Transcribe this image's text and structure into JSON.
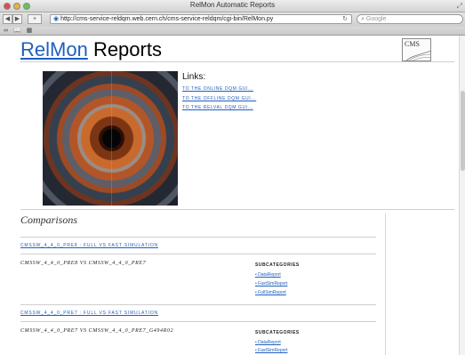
{
  "window": {
    "title": "RelMon Automatic Reports"
  },
  "toolbar": {
    "url": "http://cms-service-reldqm.web.cern.ch/cms-service-reldqm/cgi-bin/RelMon.py",
    "search_placeholder": "Google",
    "icons": [
      "back-icon",
      "forward-icon",
      "add-icon",
      "globe-icon",
      "reload-icon",
      "search-icon"
    ]
  },
  "bookmarks": {
    "icons": [
      "reading-list-icon",
      "bookmarks-icon",
      "grid-icon"
    ]
  },
  "header": {
    "brand": "RelMon",
    "title": "Reports",
    "logo_text": "CMS"
  },
  "links": {
    "title": "Links:",
    "items": [
      "TO THE ONLINE DQM GUI...",
      "TO THE OFFLINE DQM GUI...",
      "TO THE RELVAL DQM GUI..."
    ]
  },
  "comparisons": {
    "title": "Comparisons",
    "groups": [
      {
        "head": "CMSSW_4_4_0_PRE8 : FULL VS FAST SIMULATION",
        "row": "CMSSW_4_4_0_PRE8 VS CMSSW_4_4_0_PRE7",
        "subcategories_label": "SUBCATEGORIES",
        "subcategories": [
          "DataReport",
          "FastSimReport",
          "FullSimReport"
        ]
      },
      {
        "head": "CMSSW_4_4_0_PRE7 : FULL VS FAST SIMULATION",
        "row": "CMSSW_4_4_0_PRE7 VS CMSSW_4_4_0_PRE7_G494R02",
        "subcategories_label": "SUBCATEGORIES",
        "subcategories": [
          "DataReport",
          "FastSimReport"
        ]
      }
    ]
  }
}
